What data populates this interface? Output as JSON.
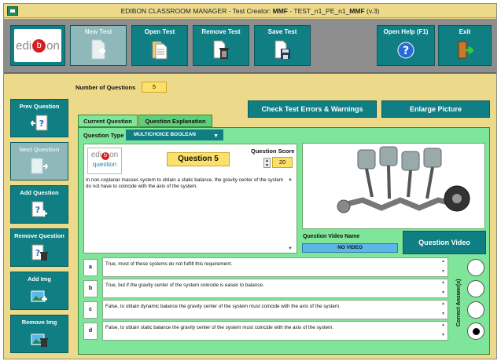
{
  "window": {
    "title_prefix": "EDIBON CLASSROOM MANAGER - Test Creator: ",
    "title_user": "MMF",
    "title_sep": " - TEST_n1_PE_n1_",
    "title_test": "MMF",
    "title_version": " (v.3)"
  },
  "toolbar": {
    "logo_left": "edi",
    "logo_mid": "o",
    "logo_right": "n",
    "logo_b": "b",
    "new_test": "New Test",
    "open_test": "Open Test",
    "remove_test": "Remove Test",
    "save_test": "Save Test",
    "open_help": "Open Help (F1)",
    "exit": "Exit"
  },
  "sidebar": {
    "prev_question": "Prev Question",
    "next_question": "Next Question",
    "add_question": "Add Question",
    "remove_question": "Remove Question",
    "add_img": "Add Img",
    "remove_img": "Remove Img"
  },
  "header": {
    "num_questions_label": "Number of Questions",
    "num_questions_value": "5",
    "check_errors": "Check Test Errors & Warnings",
    "enlarge_picture": "Enlarge Picture"
  },
  "tabs": {
    "current": "Current Question",
    "explanation": "Question Explanation"
  },
  "question": {
    "type_label": "Question Type",
    "type_value": "MULTICHOICE BOOLEAN",
    "number": "Question 5",
    "score_label": "Question Score",
    "score_value": "20",
    "text": "In non-coplanar masses system to obtain a static balance, the gravity center of the system do not have to coincide with the axis of the system.",
    "video_name_label": "Question Video Name",
    "video_name_value": "NO VIDEO",
    "video_button": "Question Video",
    "correct_label": "Correct Answer(s)",
    "mini_logo_b": "b",
    "mini_logo_edi": "edi",
    "mini_logo_on": "on",
    "mini_logo_question": "question"
  },
  "answers": [
    {
      "letter": "a",
      "text": "True, most of these systems do not fulfill this requirement.",
      "selected": false
    },
    {
      "letter": "b",
      "text": "True, but if the gravity center of the system coincide is easier to balance.",
      "selected": false
    },
    {
      "letter": "c",
      "text": "False, to obtain dynamic balance the gravity center of the system must coincide with the axis of the system.",
      "selected": false
    },
    {
      "letter": "d",
      "text": "False, to obtain static balance the gravity center of the system must coincide with the axis of the system.",
      "selected": true
    }
  ],
  "colors": {
    "accent": "#0f7f84",
    "panel_green": "#7fe59a",
    "highlight_yellow": "#fde06a",
    "background": "#ecd98a"
  }
}
